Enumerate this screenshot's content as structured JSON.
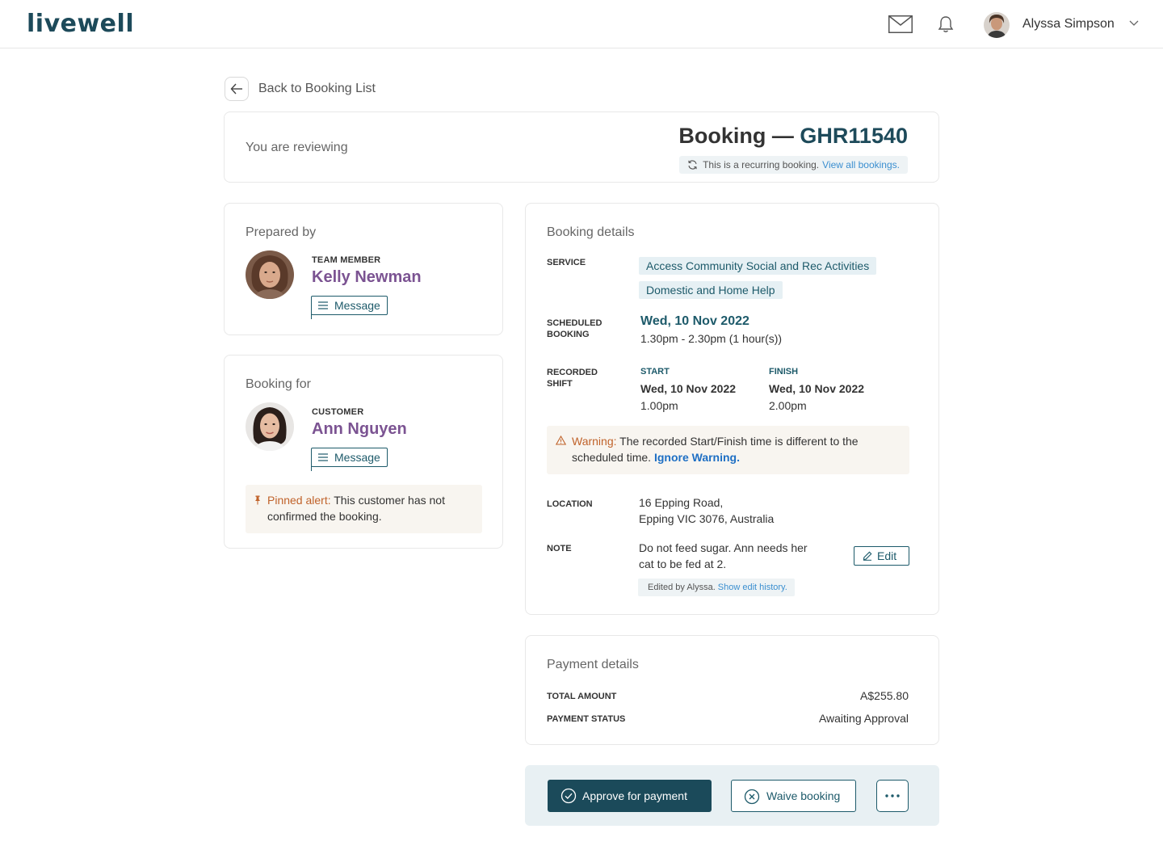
{
  "app": {
    "logo": "livewell",
    "user_name": "Alyssa Simpson"
  },
  "icons": {
    "mail": "mail-icon",
    "bell": "bell-icon",
    "chevron": "chevron-down-icon",
    "back": "arrow-left-icon",
    "recurring": "refresh-icon",
    "message": "message-icon",
    "pin": "pin-icon",
    "warning": "warning-icon",
    "edit": "pencil-icon",
    "approve": "check-circle-icon",
    "waive": "x-circle-icon",
    "more": "more-dots-icon"
  },
  "colors": {
    "brand": "#1d4a5a",
    "person_name": "#7b5392",
    "alert_label": "#c0622a",
    "link": "#1e6fc4"
  },
  "back": {
    "label": "Back to Booking List"
  },
  "review": {
    "label": "You are reviewing",
    "title_prefix": "Booking —",
    "booking_code": "GHR11540",
    "recurring_text": "This is a recurring booking.",
    "recurring_link": "View all bookings."
  },
  "prepared_by": {
    "heading": "Prepared by",
    "role": "TEAM MEMBER",
    "name": "Kelly Newman",
    "message_label": "Message"
  },
  "booking_for": {
    "heading": "Booking for",
    "role": "CUSTOMER",
    "name": "Ann Nguyen",
    "message_label": "Message",
    "alert_label": "Pinned alert:",
    "alert_text": "This customer has not confirmed the booking."
  },
  "details": {
    "heading": "Booking details",
    "service_label": "SERVICE",
    "services": [
      "Access Community Social and Rec Activities",
      "Domestic and Home Help"
    ],
    "scheduled_label_1": "SCHEDULED",
    "scheduled_label_2": "BOOKING",
    "scheduled_date": "Wed, 10 Nov 2022",
    "scheduled_time": "1.30pm - 2.30pm (1 hour(s))",
    "recorded_label_1": "RECORDED",
    "recorded_label_2": "SHIFT",
    "start_label": "START",
    "start_date": "Wed, 10 Nov 2022",
    "start_time": "1.00pm",
    "finish_label": "FINISH",
    "finish_date": "Wed, 10 Nov 2022",
    "finish_time": "2.00pm",
    "warning_label": "Warning:",
    "warning_text": "The recorded Start/Finish time is different to the scheduled time.",
    "warning_link": "Ignore Warning.",
    "location_label": "LOCATION",
    "location_line1": "16 Epping Road,",
    "location_line2": "Epping VIC 3076, Australia",
    "note_label": "NOTE",
    "note_line1": "Do not feed sugar. Ann needs her",
    "note_line2": "cat to be fed at 2.",
    "edit_label": "Edit",
    "edited_text": "Edited by Alyssa.",
    "edited_link": "Show edit history."
  },
  "payment": {
    "heading": "Payment details",
    "total_label": "TOTAL AMOUNT",
    "total_value": "A$255.80",
    "status_label": "PAYMENT STATUS",
    "status_value": "Awaiting Approval"
  },
  "actions": {
    "approve_label": "Approve for payment",
    "waive_label": "Waive booking"
  }
}
